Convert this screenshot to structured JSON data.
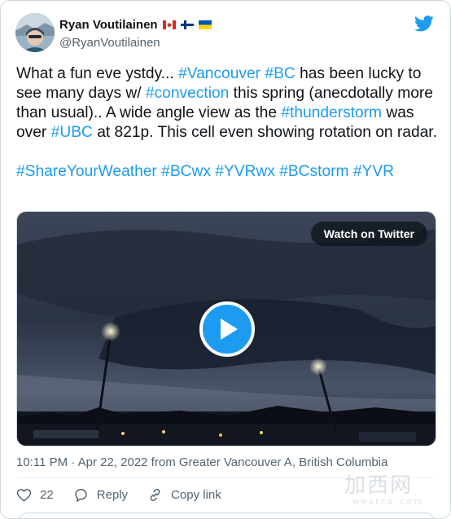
{
  "author": {
    "name": "Ryan Voutilainen",
    "handle": "@RyanVoutilainen",
    "flags": [
      "canada-flag",
      "finland-flag",
      "ukraine-flag"
    ]
  },
  "tweet": {
    "segments_p1": [
      {
        "t": "What a fun eve ystdy... ",
        "tag": false
      },
      {
        "t": "#Vancouver",
        "tag": true
      },
      {
        "t": " ",
        "tag": false
      },
      {
        "t": "#BC",
        "tag": true
      },
      {
        "t": " has been lucky to see many days w/ ",
        "tag": false
      },
      {
        "t": "#convection",
        "tag": true
      },
      {
        "t": " this spring (anecdotally more than usual).. A wide angle view as the ",
        "tag": false
      },
      {
        "t": "#thunderstorm",
        "tag": true
      },
      {
        "t": " was over ",
        "tag": false
      },
      {
        "t": "#UBC",
        "tag": true
      },
      {
        "t": " at 821p. This cell even showing rotation on radar.",
        "tag": false
      }
    ],
    "hashtags_p2": [
      "#ShareYourWeather",
      "#BCwx",
      "#YVRwx",
      "#BCstorm",
      "#YVR"
    ]
  },
  "media": {
    "watch_label": "Watch on Twitter"
  },
  "meta": {
    "time": "10:11 PM",
    "separator": " · ",
    "date": "Apr 22, 2022",
    "source": " from Greater Vancouver A, British Columbia"
  },
  "actions": {
    "like_count": "22",
    "reply_label": "Reply",
    "copy_label": "Copy link"
  },
  "watermark": {
    "cn": "加西网",
    "en": "westca.com"
  },
  "colors": {
    "accent": "#1d9bf0",
    "text": "#0f1419",
    "muted": "#536471"
  }
}
